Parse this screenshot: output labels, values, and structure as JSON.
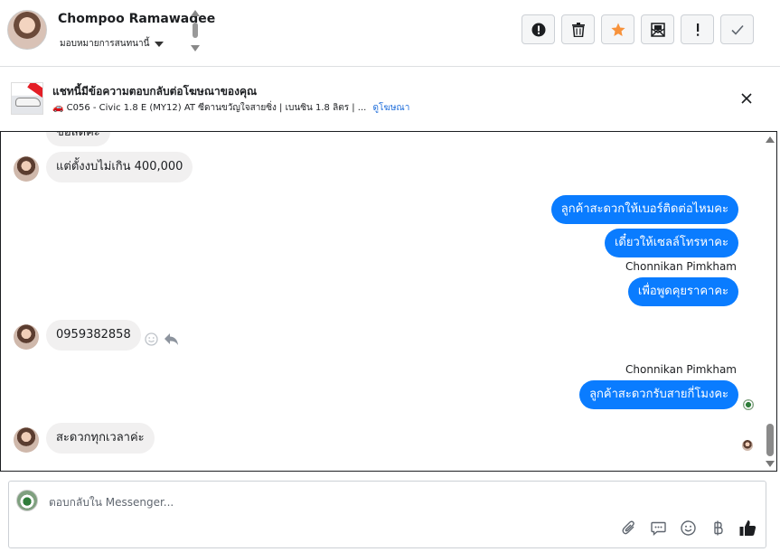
{
  "header": {
    "contact_name": "Chompoo Ramawadee",
    "assign_label": "มอบหมายการสนทนานี้",
    "actions": [
      {
        "name": "mark-spam-button",
        "icon": "alert-circle-icon"
      },
      {
        "name": "delete-button",
        "icon": "trash-icon"
      },
      {
        "name": "star-button",
        "icon": "star-icon"
      },
      {
        "name": "mark-unread-button",
        "icon": "mail-open-icon"
      },
      {
        "name": "important-button",
        "icon": "exclamation-icon"
      },
      {
        "name": "mark-done-button",
        "icon": "check-icon"
      }
    ],
    "colors": {
      "star": "#f7923b"
    }
  },
  "ad": {
    "title": "แชทนี้มีข้อความตอบกลับต่อโฆษณาของคุณ",
    "subtitle": "🚗 C056 - Civic 1.8 E (MY12) AT ซีดานขวัญใจสายซิ่ง | เบนซิน 1.8 ลิตร | ...",
    "link": "ดูโฆษณา"
  },
  "messages": {
    "partial_top": "ขอสดคะ",
    "m1": "แต่ตั้งงบไม่เกิน 400,000",
    "o1": "ลูกค้าสะดวกให้เบอร์ติดต่อไหมคะ",
    "o2": "เดี๋ยวให้เซลล์โทรหาคะ",
    "o3_sender": "Chonnikan Pimkham",
    "o3": "เพื่อพูดคุยราคาคะ",
    "m2": "0959382858",
    "o4_sender": "Chonnikan Pimkham",
    "o4": "ลูกค้าสะดวกรับสายกี่โมงคะ",
    "m3": "สะดวกทุกเวลาค่ะ"
  },
  "composer": {
    "placeholder": "ตอบกลับใน Messenger...",
    "icons": [
      "paperclip-icon",
      "saved-replies-icon",
      "emoji-icon",
      "baht-payment-icon",
      "thumbs-up-icon"
    ]
  },
  "colors": {
    "outgoing_bubble": "#0a7cff",
    "incoming_bubble": "#f1f0f0",
    "link": "#216fdb"
  }
}
